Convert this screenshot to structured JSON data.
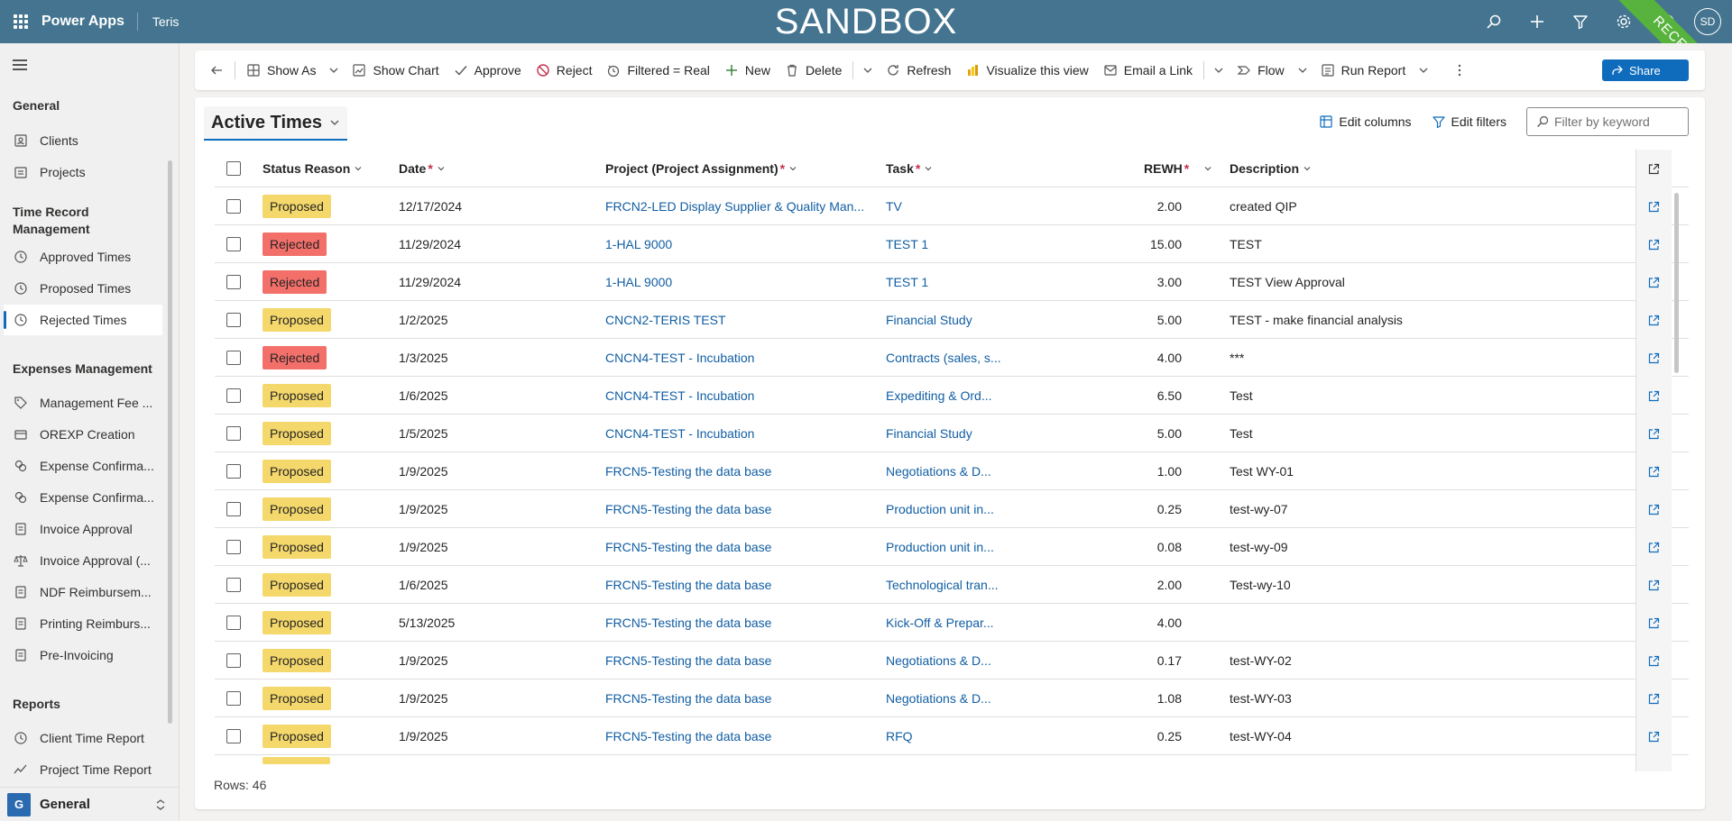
{
  "topbar": {
    "app_name": "Power Apps",
    "env_name": "Teris",
    "environment_banner": "SANDBOX",
    "user_initials": "SD",
    "ribbon_label": "RECETTE"
  },
  "sidebar": {
    "sections": [
      {
        "title": "General",
        "items": [
          {
            "label": "Clients",
            "icon": "person-icon"
          },
          {
            "label": "Projects",
            "icon": "folder-icon"
          }
        ]
      },
      {
        "title": "Time Record Management",
        "items": [
          {
            "label": "Approved Times",
            "icon": "clock-icon"
          },
          {
            "label": "Proposed Times",
            "icon": "clock-icon"
          },
          {
            "label": "Rejected Times",
            "icon": "clock-icon",
            "active": true
          }
        ]
      },
      {
        "title": "Expenses Management",
        "items": [
          {
            "label": "Management Fee ...",
            "icon": "tag-icon"
          },
          {
            "label": "OREXP Creation",
            "icon": "receipt-icon"
          },
          {
            "label": "Expense Confirma...",
            "icon": "money-icon"
          },
          {
            "label": "Expense Confirma...",
            "icon": "money-icon"
          },
          {
            "label": "Invoice Approval",
            "icon": "document-icon"
          },
          {
            "label": "Invoice Approval (...",
            "icon": "scale-icon"
          },
          {
            "label": "NDF Reimbursem...",
            "icon": "document-icon"
          },
          {
            "label": "Printing Reimburs...",
            "icon": "document-icon"
          },
          {
            "label": "Pre-Invoicing",
            "icon": "document-icon"
          }
        ]
      },
      {
        "title": "Reports",
        "items": [
          {
            "label": "Client Time Report",
            "icon": "clock-icon"
          },
          {
            "label": "Project Time Report",
            "icon": "trend-icon"
          }
        ]
      }
    ],
    "area": {
      "badge": "G",
      "label": "General"
    }
  },
  "commandbar": {
    "show_as": "Show As",
    "show_chart": "Show Chart",
    "approve": "Approve",
    "reject": "Reject",
    "filtered": "Filtered = Real",
    "new": "New",
    "delete": "Delete",
    "refresh": "Refresh",
    "visualize": "Visualize this view",
    "email_link": "Email a Link",
    "flow": "Flow",
    "run_report": "Run Report",
    "share": "Share"
  },
  "view": {
    "title": "Active Times",
    "edit_columns": "Edit columns",
    "edit_filters": "Edit filters",
    "filter_placeholder": "Filter by keyword",
    "rows_label": "Rows: 46"
  },
  "columns": {
    "status": "Status Reason",
    "date": "Date",
    "project": "Project (Project Assignment)",
    "task": "Task",
    "rewh": "REWH",
    "description": "Description"
  },
  "status_colors": {
    "Proposed": "#f5d86b",
    "Rejected": "#f36f6a"
  },
  "rows": [
    {
      "status": "Proposed",
      "date": "12/17/2024",
      "project": "FRCN2-LED Display Supplier & Quality Man...",
      "task": "TV",
      "rewh": "2.00",
      "description": "created QIP"
    },
    {
      "status": "Rejected",
      "date": "11/29/2024",
      "project": "1-HAL 9000",
      "task": "TEST 1",
      "rewh": "15.00",
      "description": "TEST"
    },
    {
      "status": "Rejected",
      "date": "11/29/2024",
      "project": "1-HAL 9000",
      "task": "TEST 1",
      "rewh": "3.00",
      "description": "TEST View Approval"
    },
    {
      "status": "Proposed",
      "date": "1/2/2025",
      "project": "CNCN2-TERIS TEST",
      "task": "Financial Study",
      "rewh": "5.00",
      "description": "TEST - make financial analysis"
    },
    {
      "status": "Rejected",
      "date": "1/3/2025",
      "project": "CNCN4-TEST - Incubation",
      "task": "Contracts (sales, s...",
      "rewh": "4.00",
      "description": "***"
    },
    {
      "status": "Proposed",
      "date": "1/6/2025",
      "project": "CNCN4-TEST - Incubation",
      "task": "Expediting & Ord...",
      "rewh": "6.50",
      "description": "Test"
    },
    {
      "status": "Proposed",
      "date": "1/5/2025",
      "project": "CNCN4-TEST - Incubation",
      "task": "Financial Study",
      "rewh": "5.00",
      "description": "Test"
    },
    {
      "status": "Proposed",
      "date": "1/9/2025",
      "project": "FRCN5-Testing the data base",
      "task": "Negotiations & D...",
      "rewh": "1.00",
      "description": "Test WY-01"
    },
    {
      "status": "Proposed",
      "date": "1/9/2025",
      "project": "FRCN5-Testing the data base",
      "task": "Production unit in...",
      "rewh": "0.25",
      "description": "test-wy-07"
    },
    {
      "status": "Proposed",
      "date": "1/9/2025",
      "project": "FRCN5-Testing the data base",
      "task": "Production unit in...",
      "rewh": "0.08",
      "description": "test-wy-09"
    },
    {
      "status": "Proposed",
      "date": "1/6/2025",
      "project": "FRCN5-Testing the data base",
      "task": "Technological tran...",
      "rewh": "2.00",
      "description": "Test-wy-10"
    },
    {
      "status": "Proposed",
      "date": "5/13/2025",
      "project": "FRCN5-Testing the data base",
      "task": "Kick-Off & Prepar...",
      "rewh": "4.00",
      "description": ""
    },
    {
      "status": "Proposed",
      "date": "1/9/2025",
      "project": "FRCN5-Testing the data base",
      "task": "Negotiations & D...",
      "rewh": "0.17",
      "description": "test-WY-02"
    },
    {
      "status": "Proposed",
      "date": "1/9/2025",
      "project": "FRCN5-Testing the data base",
      "task": "Negotiations & D...",
      "rewh": "1.08",
      "description": "test-WY-03"
    },
    {
      "status": "Proposed",
      "date": "1/9/2025",
      "project": "FRCN5-Testing the data base",
      "task": "RFQ",
      "rewh": "0.25",
      "description": "test-WY-04"
    }
  ]
}
